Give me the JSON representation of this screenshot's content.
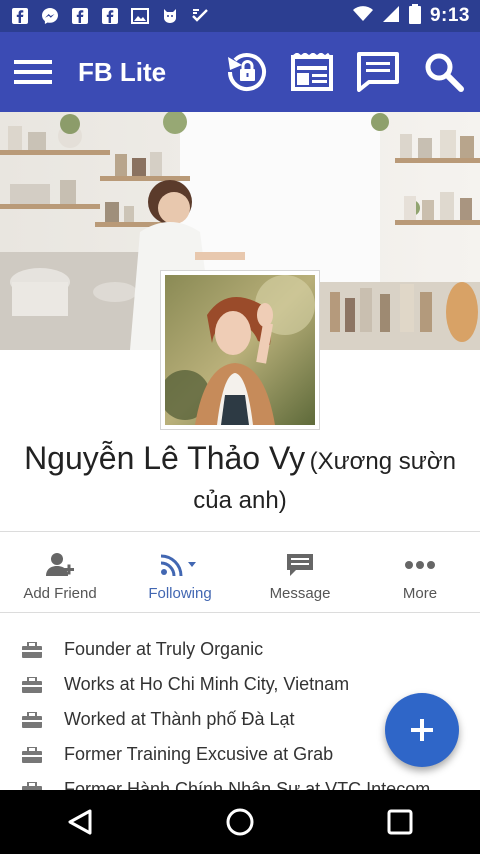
{
  "status_bar": {
    "time": "9:13",
    "notification_icons": [
      "facebook-icon",
      "messenger-icon",
      "facebook-icon",
      "facebook-icon",
      "image-icon",
      "cat-icon",
      "checklist-icon"
    ],
    "system_icons": [
      "wifi-icon",
      "signal-icon",
      "battery-icon"
    ]
  },
  "app_bar": {
    "title": "FB Lite",
    "actions": [
      "friend-requests-icon",
      "news-feed-icon",
      "messages-icon",
      "search-icon"
    ]
  },
  "profile": {
    "name": "Nguyễn Lê Thảo Vy",
    "nickname": "(Xương sườn của anh)"
  },
  "actions": [
    {
      "label": "Add Friend",
      "icon": "add-friend-icon"
    },
    {
      "label": "Following",
      "icon": "following-icon"
    },
    {
      "label": "Message",
      "icon": "message-icon"
    },
    {
      "label": "More",
      "icon": "more-icon"
    }
  ],
  "info": [
    "Founder at Truly Organic",
    "Works at Ho Chi Minh City, Vietnam",
    "Worked at Thành phố Đà Lạt",
    "Former Training Excusive at Grab",
    "Former Hành Chính Nhân Sự at VTC Intecom"
  ],
  "colors": {
    "app_bar": "#3b4bb4",
    "status_bar": "#2c3e91",
    "accent": "#4267b2",
    "fab": "#2f66c8"
  },
  "nav_bar": [
    "back-icon",
    "home-icon",
    "recents-icon"
  ]
}
